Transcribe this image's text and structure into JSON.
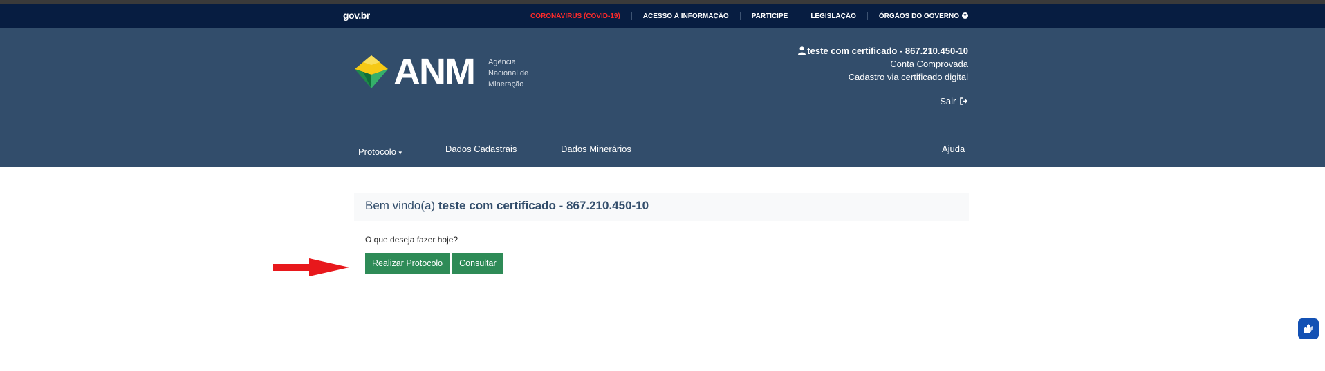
{
  "govbar": {
    "logo": "gov.br",
    "links": [
      "CORONAVÍRUS (COVID-19)",
      "ACESSO À INFORMAÇÃO",
      "PARTICIPE",
      "LEGISLAÇÃO",
      "ÓRGÃOS DO GOVERNO"
    ]
  },
  "brand": {
    "name": "ANM",
    "subtitle_1": "Agência",
    "subtitle_2": "Nacional de",
    "subtitle_3": "Mineração"
  },
  "user": {
    "name": "teste com certificado",
    "separator": " - ",
    "cpf": "867.210.450-10",
    "status": "Conta Comprovada",
    "registration": "Cadastro via certificado digital",
    "logout": "Sair"
  },
  "nav": {
    "protocolo": "Protocolo",
    "dados_cadastrais": "Dados Cadastrais",
    "dados_minerarios": "Dados Minerários",
    "ajuda": "Ajuda"
  },
  "main": {
    "welcome_prefix": "Bem vindo(a) ",
    "welcome_name": "teste com certificado",
    "welcome_sep": " - ",
    "welcome_cpf": "867.210.450-10",
    "question": "O que deseja fazer hoje?",
    "btn_protocolo": "Realizar Protocolo",
    "btn_consultar": "Consultar"
  },
  "colors": {
    "gov_bar": "#071d41",
    "header": "#324d6b",
    "button": "#2e8b57",
    "covid": "#ff2a2a",
    "arrow": "#e8181c"
  }
}
